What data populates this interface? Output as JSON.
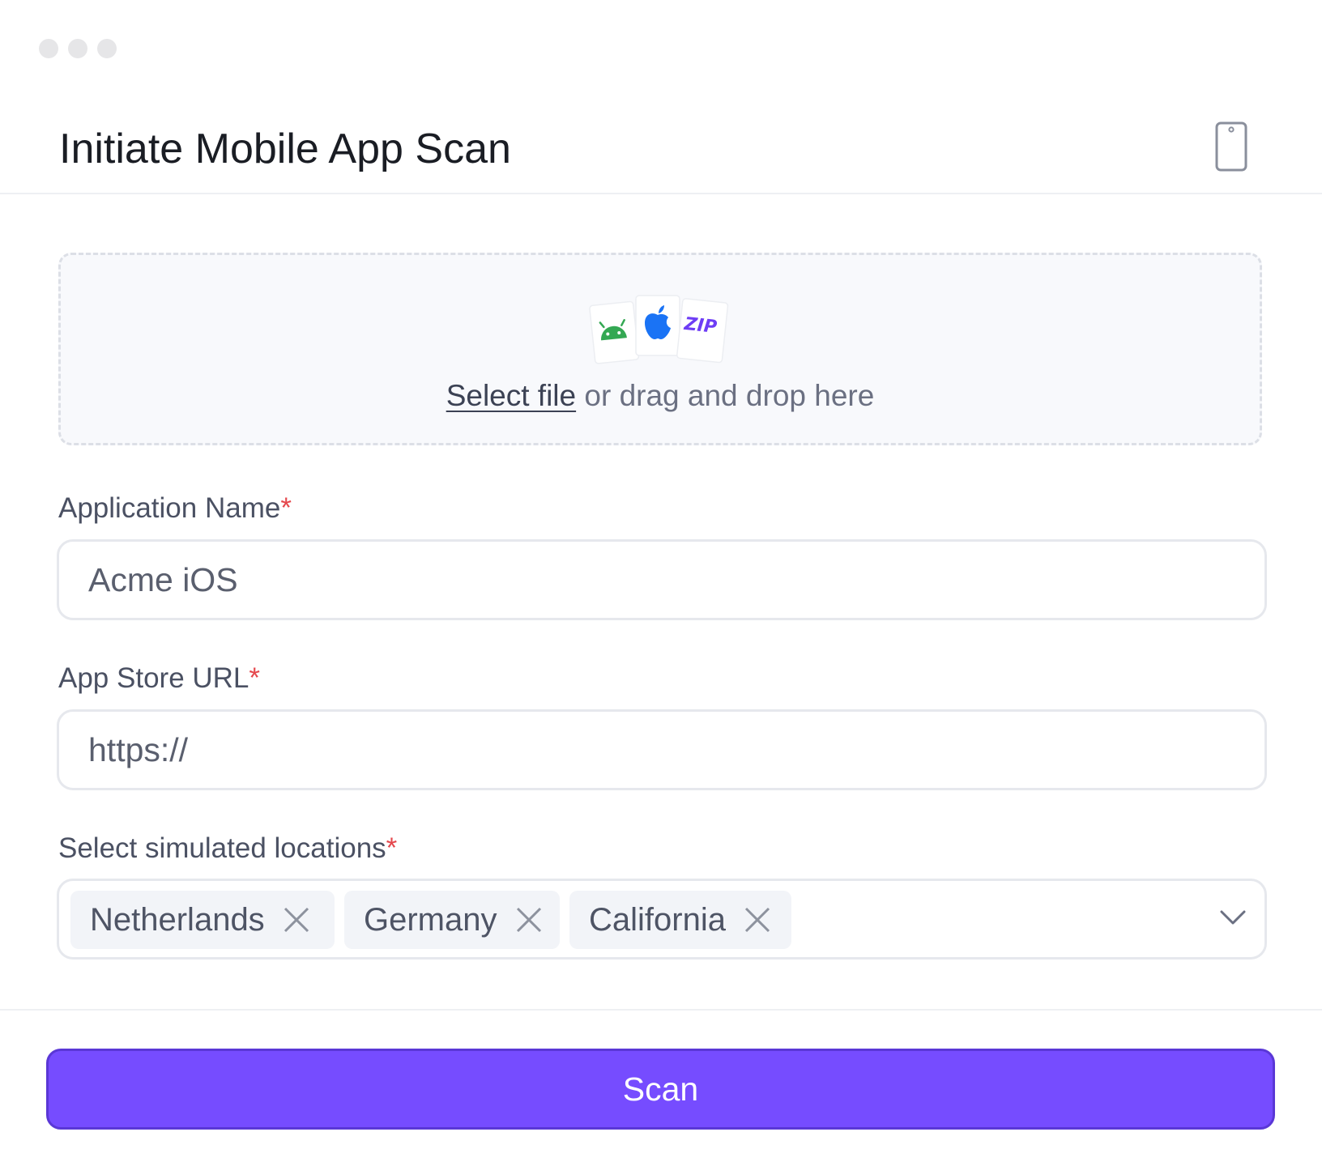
{
  "window": {
    "controls": [
      "dot",
      "dot",
      "dot"
    ]
  },
  "header": {
    "title": "Initiate Mobile App Scan",
    "icon": "mobile-phone-icon"
  },
  "upload": {
    "file_types": [
      {
        "icon": "android-icon",
        "color": "#34a853"
      },
      {
        "icon": "apple-icon",
        "color": "#1a73f5"
      },
      {
        "icon": "zip-icon",
        "label": "ZIP",
        "color": "#6e3df5"
      }
    ],
    "link_label": "Select file",
    "hint": " or drag and drop here"
  },
  "fields": {
    "app_name": {
      "label": "Application Name",
      "required_mark": "*",
      "value": "Acme iOS"
    },
    "store_url": {
      "label": "App Store URL",
      "required_mark": "*",
      "value": "https://"
    },
    "locations": {
      "label": "Select simulated locations",
      "required_mark": "*",
      "selected": [
        "Netherlands",
        "Germany",
        "California"
      ]
    }
  },
  "actions": {
    "scan_label": "Scan"
  },
  "colors": {
    "accent": "#764cff",
    "required": "#e5484d"
  }
}
